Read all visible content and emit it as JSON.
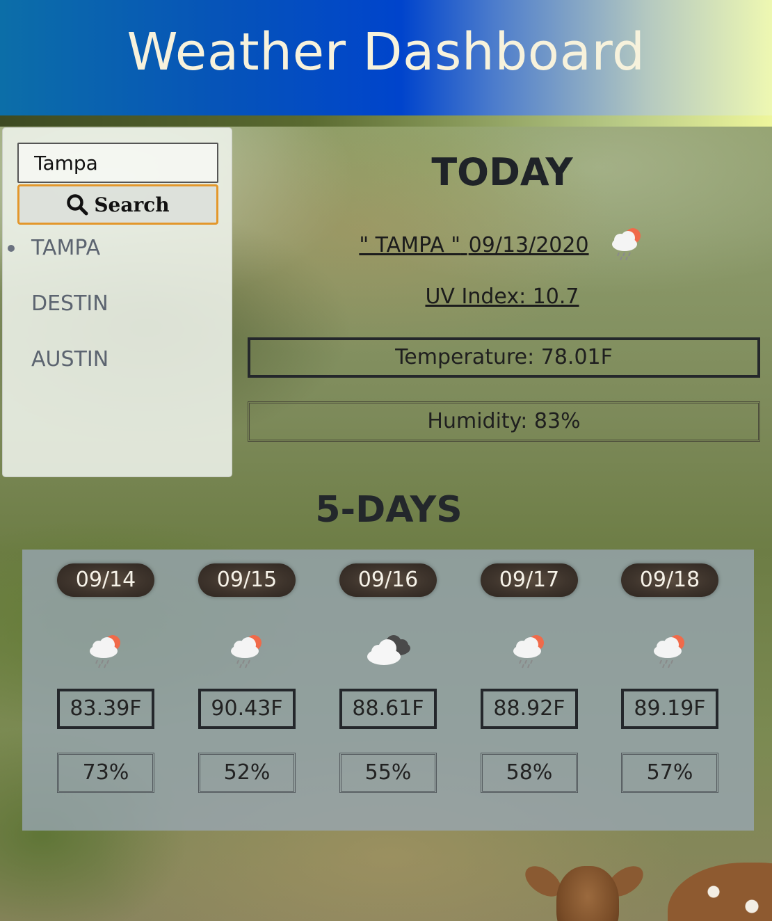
{
  "header": {
    "title": "Weather Dashboard"
  },
  "sidebar": {
    "search": {
      "value": "Tampa",
      "button_label": "Search",
      "icon": "search-icon"
    },
    "cities": [
      "TAMPA",
      "DESTIN",
      "AUSTIN"
    ]
  },
  "today": {
    "heading": "TODAY",
    "city": "\" TAMPA \"",
    "date": "09/13/2020",
    "icon": "rain-sun-cloud-icon",
    "uv_index": "UV Index: 10.7",
    "temperature": "Temperature: 78.01F",
    "humidity": "Humidity: 83%"
  },
  "forecast": {
    "heading": "5-DAYS",
    "days": [
      {
        "date": "09/14",
        "icon": "rain-sun-cloud-icon",
        "temp": "83.39F",
        "humidity": "73%"
      },
      {
        "date": "09/15",
        "icon": "rain-sun-cloud-icon",
        "temp": "90.43F",
        "humidity": "52%"
      },
      {
        "date": "09/16",
        "icon": "cloudy-icon",
        "temp": "88.61F",
        "humidity": "55%"
      },
      {
        "date": "09/17",
        "icon": "rain-sun-cloud-icon",
        "temp": "88.92F",
        "humidity": "58%"
      },
      {
        "date": "09/18",
        "icon": "rain-sun-cloud-icon",
        "temp": "89.19F",
        "humidity": "57%"
      }
    ]
  },
  "colors": {
    "header_gradient_start": "#0c6ea8",
    "header_gradient_mid": "#0044cc",
    "header_gradient_end": "#eef8b2",
    "header_title": "#f7f2dc",
    "search_button_border": "#e3972b",
    "date_pill": "#3e342c"
  }
}
